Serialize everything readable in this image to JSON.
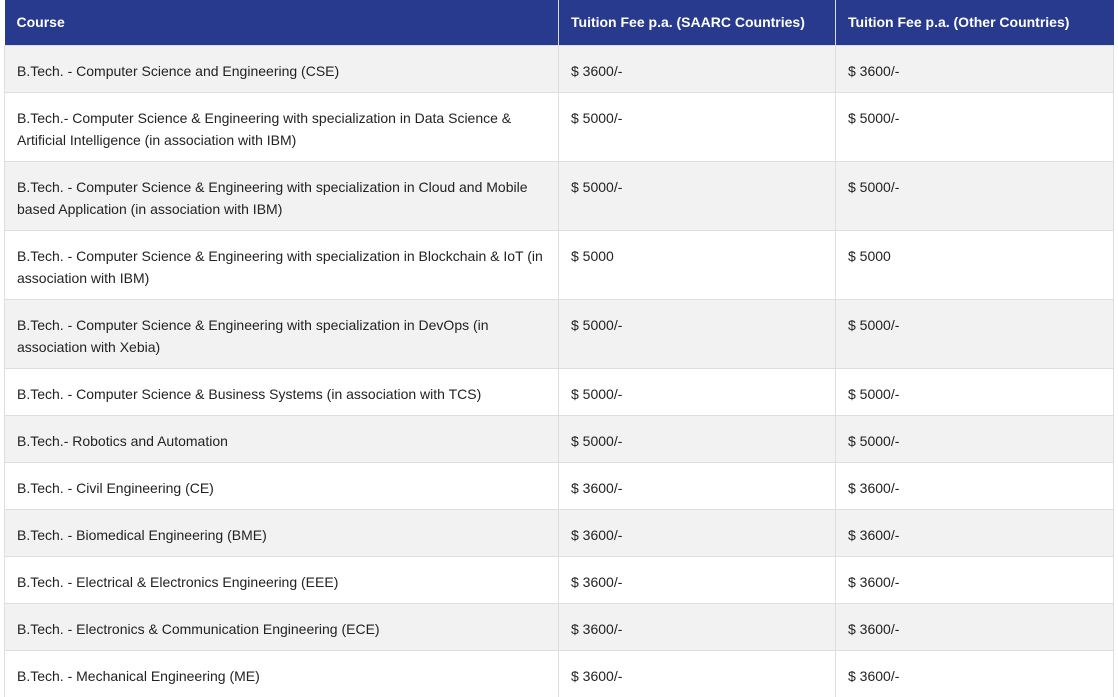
{
  "table": {
    "headers": {
      "course": "Course",
      "saarc": "Tuition Fee p.a. (SAARC Countries)",
      "other": "Tuition Fee p.a. (Other Countries)"
    },
    "rows": [
      {
        "course": "B.Tech. - Computer Science and Engineering (CSE)",
        "saarc": "$ 3600/-",
        "other": "$ 3600/-"
      },
      {
        "course": "B.Tech.- Computer Science & Engineering with specialization in Data Science & Artificial Intelligence (in association with IBM)",
        "saarc": "$ 5000/-",
        "other": "$ 5000/-"
      },
      {
        "course": "B.Tech. - Computer Science & Engineering with specialization in Cloud and Mobile based Application (in association with IBM)",
        "saarc": "$ 5000/-",
        "other": "$ 5000/-"
      },
      {
        "course": "B.Tech. - Computer Science & Engineering with specialization in Blockchain & IoT (in association with IBM)",
        "saarc": "$ 5000",
        "other": "$ 5000"
      },
      {
        "course": "B.Tech. - Computer Science & Engineering with specialization in DevOps (in association with Xebia)",
        "saarc": "$ 5000/-",
        "other": "$ 5000/-"
      },
      {
        "course": "B.Tech. - Computer Science & Business Systems (in association with TCS)",
        "saarc": "$ 5000/-",
        "other": "$ 5000/-"
      },
      {
        "course": "B.Tech.- Robotics and Automation",
        "saarc": "$ 5000/-",
        "other": "$ 5000/-"
      },
      {
        "course": "B.Tech. - Civil Engineering (CE)",
        "saarc": "$ 3600/-",
        "other": "$ 3600/-"
      },
      {
        "course": "B.Tech. - Biomedical Engineering (BME)",
        "saarc": "$ 3600/-",
        "other": "$ 3600/-"
      },
      {
        "course": "B.Tech. - Electrical & Electronics Engineering (EEE)",
        "saarc": "$ 3600/-",
        "other": "$ 3600/-"
      },
      {
        "course": "B.Tech. - Electronics & Communication Engineering (ECE)",
        "saarc": "$ 3600/-",
        "other": "$ 3600/-"
      },
      {
        "course": "B.Tech. - Mechanical Engineering (ME)",
        "saarc": "$ 3600/-",
        "other": "$ 3600/-"
      }
    ]
  },
  "colors": {
    "header_bg": "#283a8e",
    "header_text": "#ffffff",
    "row_alt_bg": "#f2f2f2",
    "row_bg": "#ffffff"
  }
}
